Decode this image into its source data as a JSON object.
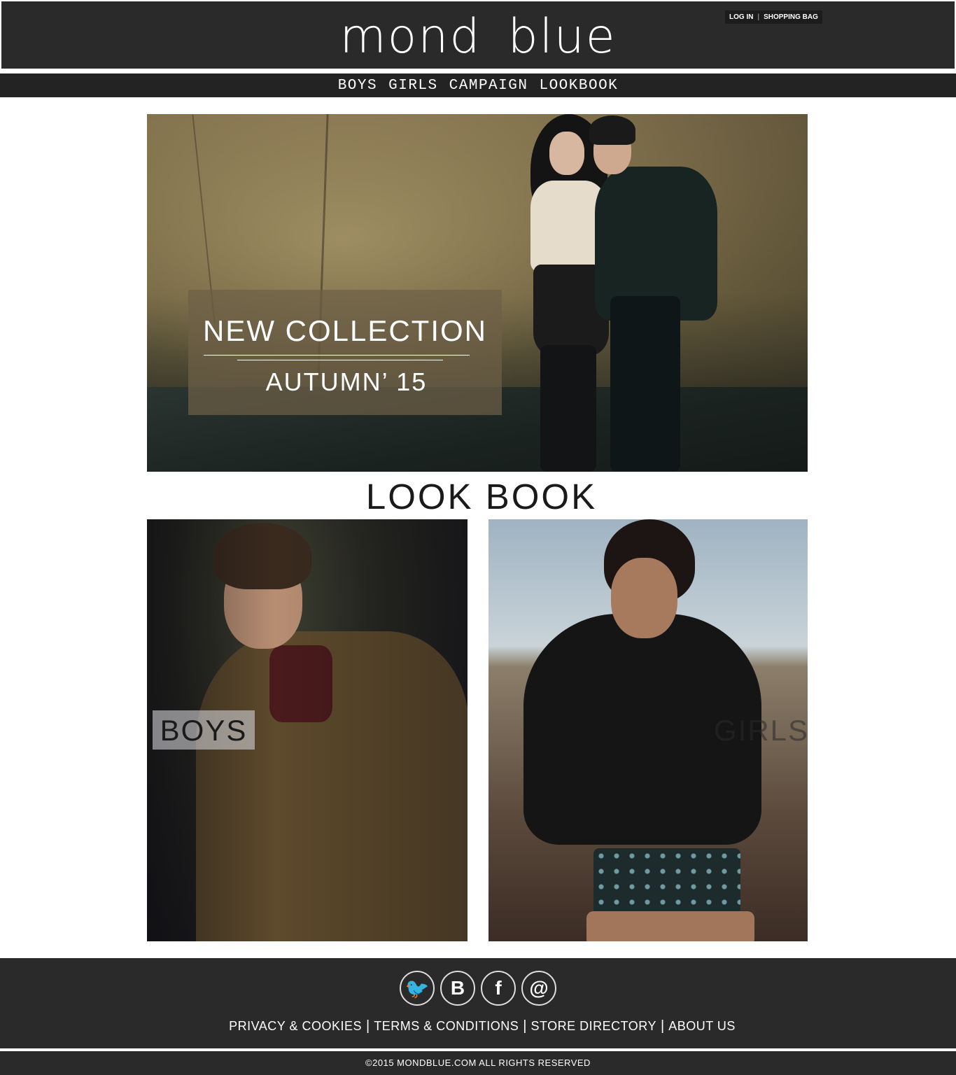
{
  "header": {
    "brand_word1": "mond",
    "brand_word2": "blue",
    "login_label": "LOG IN",
    "bag_label": "SHOPPING BAG"
  },
  "nav": {
    "items": [
      "BOYS",
      "GIRLS",
      "CAMPAIGN",
      "LOOKBOOK"
    ]
  },
  "hero": {
    "title": "NEW COLLECTION",
    "subtitle": "AUTUMN’ 15"
  },
  "lookbook": {
    "heading": "LOOK BOOK",
    "boys_label": "BOYS",
    "girls_label": "GIRLS"
  },
  "footer": {
    "social_icons": [
      "twitter-icon",
      "vk-icon",
      "facebook-icon",
      "email-icon"
    ],
    "social_glyphs": [
      "🐦",
      "B",
      "f",
      "@"
    ],
    "links": [
      "PRIVACY & COOKIES",
      "TERMS & CONDITIONS",
      "STORE DIRECTORY",
      "ABOUT US"
    ],
    "copyright": "©2015 MONDBLUE.COM  ALL RIGHTS RESERVED"
  },
  "colors": {
    "header_bg": "#2a2a2a",
    "nav_bg": "#232323",
    "footer_bg": "#2a2a2a",
    "text_light": "#ffffff",
    "text_dark": "#1a1a1a"
  }
}
